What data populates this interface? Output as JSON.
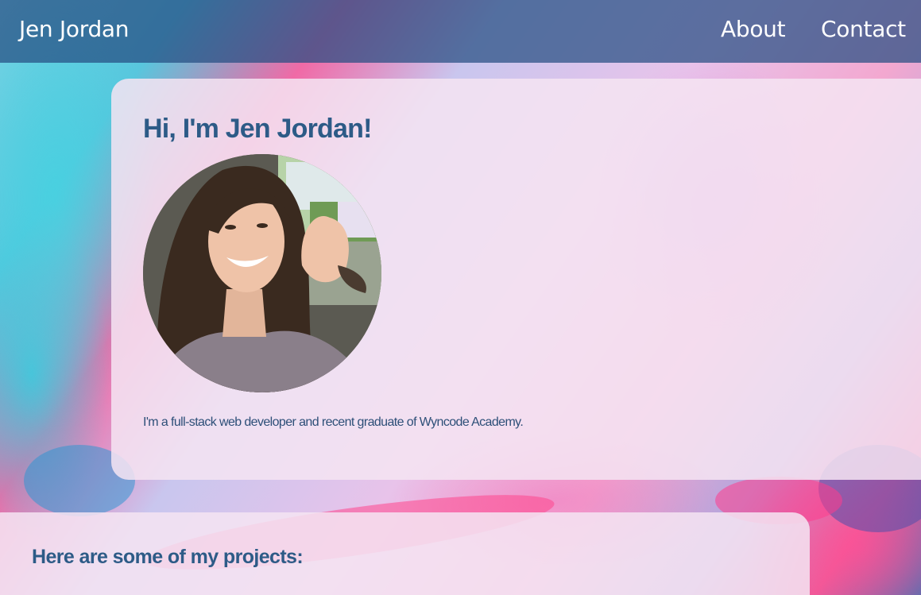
{
  "header": {
    "brand": "Jen Jordan",
    "nav": [
      {
        "label": "About"
      },
      {
        "label": "Contact"
      }
    ]
  },
  "intro": {
    "title": "Hi, I'm Jen Jordan!",
    "photo_icon": "profile-photo",
    "bio": "I'm a full-stack web developer and recent graduate of Wyncode Academy."
  },
  "projects": {
    "title": "Here are some of my projects:"
  },
  "colors": {
    "header_bg": "#264e82",
    "heading": "#2d5b87",
    "body_text": "#2d4f78",
    "card_bg": "#f5e4f2"
  }
}
